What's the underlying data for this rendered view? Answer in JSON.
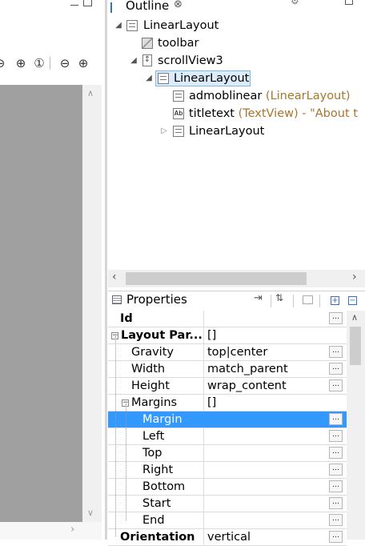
{
  "outline": {
    "tab_label": "Outline",
    "tree": [
      {
        "name": "LinearLayout",
        "type": "",
        "extra": ""
      },
      {
        "name": "toolbar",
        "type": "",
        "extra": ""
      },
      {
        "name": "scrollView3",
        "type": "",
        "extra": ""
      },
      {
        "name": "LinearLayout",
        "type": "",
        "extra": ""
      },
      {
        "name": "admoblinear",
        "type": "(LinearLayout)",
        "extra": ""
      },
      {
        "name": "titletext",
        "type": "(TextView)",
        "extra": "- \"About t"
      },
      {
        "name": "LinearLayout",
        "type": "",
        "extra": ""
      }
    ],
    "textview_icon_label": "Ab"
  },
  "properties": {
    "title": "Properties",
    "rows": [
      {
        "name": "Id",
        "value": ""
      },
      {
        "name": "Layout Par...",
        "value": "[]"
      },
      {
        "name": "Gravity",
        "value": "top|center"
      },
      {
        "name": "Width",
        "value": "match_parent"
      },
      {
        "name": "Height",
        "value": "wrap_content"
      },
      {
        "name": "Margins",
        "value": "[]"
      },
      {
        "name": "Margin",
        "value": ""
      },
      {
        "name": "Left",
        "value": ""
      },
      {
        "name": "Top",
        "value": ""
      },
      {
        "name": "Right",
        "value": ""
      },
      {
        "name": "Bottom",
        "value": ""
      },
      {
        "name": "Start",
        "value": ""
      },
      {
        "name": "End",
        "value": ""
      },
      {
        "name": "Orientation",
        "value": "vertical"
      }
    ],
    "dots_label": "…"
  },
  "colors": {
    "selection": "#3399ff",
    "canvas": "#a0a0a0",
    "type_text": "#a8762e"
  }
}
